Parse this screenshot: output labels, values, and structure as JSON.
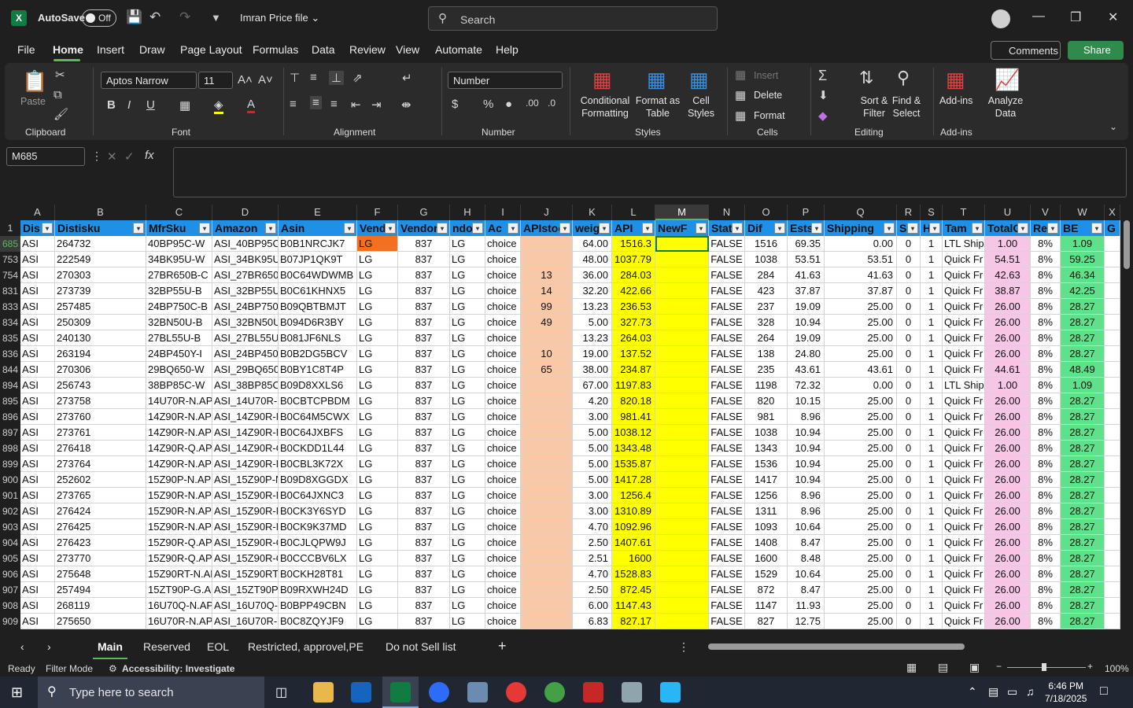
{
  "title_bar": {
    "logo": "X",
    "autosave_label": "AutoSave",
    "autosave_state": "Off",
    "file_name": "Imran Price file",
    "search_placeholder": "Search"
  },
  "menu": {
    "tabs": [
      "File",
      "Home",
      "Insert",
      "Draw",
      "Page Layout",
      "Formulas",
      "Data",
      "Review",
      "View",
      "Automate",
      "Help"
    ],
    "active_tab": "Home",
    "comments_label": "Comments",
    "share_label": "Share"
  },
  "ribbon": {
    "clipboard": {
      "paste": "Paste",
      "label": "Clipboard"
    },
    "font": {
      "name": "Aptos Narrow",
      "size": "11",
      "label": "Font"
    },
    "alignment": {
      "label": "Alignment"
    },
    "number": {
      "format": "Number",
      "label": "Number"
    },
    "styles": {
      "conditional": "Conditional\nFormatting",
      "format_table": "Format as\nTable",
      "cell_styles": "Cell\nStyles",
      "label": "Styles"
    },
    "cells": {
      "insert": "Insert",
      "delete": "Delete",
      "format": "Format",
      "label": "Cells"
    },
    "editing": {
      "sort_filter": "Sort &\nFilter",
      "find_select": "Find &\nSelect",
      "label": "Editing"
    },
    "addins": {
      "addins": "Add-ins",
      "analyze": "Analyze\nData",
      "label": "Add-ins"
    }
  },
  "formula_bar": {
    "name_box": "M685",
    "content": ""
  },
  "columns": [
    "A",
    "B",
    "C",
    "D",
    "E",
    "F",
    "G",
    "H",
    "I",
    "J",
    "K",
    "L",
    "M",
    "N",
    "O",
    "P",
    "Q",
    "R",
    "S",
    "T",
    "U",
    "V",
    "W",
    "X"
  ],
  "header_row_number": "1",
  "headers": [
    "Dis",
    "Distisku",
    "MfrSku",
    "Amazon",
    "Asin",
    "Vend",
    "Vendor",
    "ndor",
    "Ac",
    "APIstoc",
    "weig",
    "API",
    "NewF",
    "Stat",
    "Dif",
    "Ests",
    "Shipping",
    "Su",
    "H",
    "Tam",
    "TotalC",
    "Re",
    "BE",
    "G"
  ],
  "rows": [
    [
      "685",
      "ASI",
      "264732",
      "40BP95C-W",
      "ASI_40BP95C-",
      "B0B1NRCJK7",
      "LG",
      "837",
      "LG",
      "choice",
      "",
      "64.00",
      "1516.3",
      "",
      "FALSE",
      "1516",
      "69.35",
      "0.00",
      "0",
      "1",
      "LTL Shipp",
      "1.00",
      "8%",
      "1.09"
    ],
    [
      "753",
      "ASI",
      "222549",
      "34BK95U-W",
      "ASI_34BK95U-",
      "B07JP1QK9T",
      "LG",
      "837",
      "LG",
      "choice",
      "",
      "48.00",
      "1037.79",
      "",
      "FALSE",
      "1038",
      "53.51",
      "53.51",
      "0",
      "1",
      "Quick Fr",
      "54.51",
      "8%",
      "59.25"
    ],
    [
      "754",
      "ASI",
      "270303",
      "27BR650B-C",
      "ASI_27BR650B",
      "B0C64WDWMB",
      "LG",
      "837",
      "LG",
      "choice",
      "13",
      "36.00",
      "284.03",
      "",
      "FALSE",
      "284",
      "41.63",
      "41.63",
      "0",
      "1",
      "Quick Fr",
      "42.63",
      "8%",
      "46.34"
    ],
    [
      "831",
      "ASI",
      "273739",
      "32BP55U-B",
      "ASI_32BP55U-",
      "B0C61KHNX5",
      "LG",
      "837",
      "LG",
      "choice",
      "14",
      "32.20",
      "422.66",
      "",
      "FALSE",
      "423",
      "37.87",
      "37.87",
      "0",
      "1",
      "Quick Fr",
      "38.87",
      "8%",
      "42.25"
    ],
    [
      "833",
      "ASI",
      "257485",
      "24BP750C-B",
      "ASI_24BP750C",
      "B09QBTBMJT",
      "LG",
      "837",
      "LG",
      "choice",
      "99",
      "13.23",
      "236.53",
      "",
      "FALSE",
      "237",
      "19.09",
      "25.00",
      "0",
      "1",
      "Quick Fr",
      "26.00",
      "8%",
      "28.27"
    ],
    [
      "834",
      "ASI",
      "250309",
      "32BN50U-B",
      "ASI_32BN50U",
      "B094D6R3BY",
      "LG",
      "837",
      "LG",
      "choice",
      "49",
      "5.00",
      "327.73",
      "",
      "FALSE",
      "328",
      "10.94",
      "25.00",
      "0",
      "1",
      "Quick Fr",
      "26.00",
      "8%",
      "28.27"
    ],
    [
      "835",
      "ASI",
      "240130",
      "27BL55U-B",
      "ASI_27BL55U-",
      "B081JF6NLS",
      "LG",
      "837",
      "LG",
      "choice",
      "",
      "13.23",
      "264.03",
      "",
      "FALSE",
      "264",
      "19.09",
      "25.00",
      "0",
      "1",
      "Quick Fr",
      "26.00",
      "8%",
      "28.27"
    ],
    [
      "836",
      "ASI",
      "263194",
      "24BP450Y-I",
      "ASI_24BP450Y",
      "B0B2DG5BCV",
      "LG",
      "837",
      "LG",
      "choice",
      "10",
      "19.00",
      "137.52",
      "",
      "FALSE",
      "138",
      "24.80",
      "25.00",
      "0",
      "1",
      "Quick Fr",
      "26.00",
      "8%",
      "28.27"
    ],
    [
      "844",
      "ASI",
      "270306",
      "29BQ650-W",
      "ASI_29BQ650-",
      "B0BY1C8T4P",
      "LG",
      "837",
      "LG",
      "choice",
      "65",
      "38.00",
      "234.87",
      "",
      "FALSE",
      "235",
      "43.61",
      "43.61",
      "0",
      "1",
      "Quick Fr",
      "44.61",
      "8%",
      "48.49"
    ],
    [
      "894",
      "ASI",
      "256743",
      "38BP85C-W",
      "ASI_38BP85C-",
      "B09D8XXLS6",
      "LG",
      "837",
      "LG",
      "choice",
      "",
      "67.00",
      "1197.83",
      "",
      "FALSE",
      "1198",
      "72.32",
      "0.00",
      "0",
      "1",
      "LTL Shipp",
      "1.00",
      "8%",
      "1.09"
    ],
    [
      "895",
      "ASI",
      "273758",
      "14U70R-N.AP",
      "ASI_14U70R-N",
      "B0CBTCPBDM",
      "LG",
      "837",
      "LG",
      "choice",
      "",
      "4.20",
      "820.18",
      "",
      "FALSE",
      "820",
      "10.15",
      "25.00",
      "0",
      "1",
      "Quick Fr",
      "26.00",
      "8%",
      "28.27"
    ],
    [
      "896",
      "ASI",
      "273760",
      "14Z90R-N.AP",
      "ASI_14Z90R-N",
      "B0C64M5CWX",
      "LG",
      "837",
      "LG",
      "choice",
      "",
      "3.00",
      "981.41",
      "",
      "FALSE",
      "981",
      "8.96",
      "25.00",
      "0",
      "1",
      "Quick Fr",
      "26.00",
      "8%",
      "28.27"
    ],
    [
      "897",
      "ASI",
      "273761",
      "14Z90R-N.AP",
      "ASI_14Z90R-N",
      "B0C64JXBFS",
      "LG",
      "837",
      "LG",
      "choice",
      "",
      "5.00",
      "1038.12",
      "",
      "FALSE",
      "1038",
      "10.94",
      "25.00",
      "0",
      "1",
      "Quick Fr",
      "26.00",
      "8%",
      "28.27"
    ],
    [
      "898",
      "ASI",
      "276418",
      "14Z90R-Q.AP",
      "ASI_14Z90R-Q",
      "B0CKDD1L44",
      "LG",
      "837",
      "LG",
      "choice",
      "",
      "5.00",
      "1343.48",
      "",
      "FALSE",
      "1343",
      "10.94",
      "25.00",
      "0",
      "1",
      "Quick Fr",
      "26.00",
      "8%",
      "28.27"
    ],
    [
      "899",
      "ASI",
      "273764",
      "14Z90R-N.AP",
      "ASI_14Z90R-N",
      "B0CBL3K72X",
      "LG",
      "837",
      "LG",
      "choice",
      "",
      "5.00",
      "1535.87",
      "",
      "FALSE",
      "1536",
      "10.94",
      "25.00",
      "0",
      "1",
      "Quick Fr",
      "26.00",
      "8%",
      "28.27"
    ],
    [
      "900",
      "ASI",
      "252602",
      "15Z90P-N.AP",
      "ASI_15Z90P-N",
      "B09D8XGGDX",
      "LG",
      "837",
      "LG",
      "choice",
      "",
      "5.00",
      "1417.28",
      "",
      "FALSE",
      "1417",
      "10.94",
      "25.00",
      "0",
      "1",
      "Quick Fr",
      "26.00",
      "8%",
      "28.27"
    ],
    [
      "901",
      "ASI",
      "273765",
      "15Z90R-N.AP",
      "ASI_15Z90R-N",
      "B0C64JXNC3",
      "LG",
      "837",
      "LG",
      "choice",
      "",
      "3.00",
      "1256.4",
      "",
      "FALSE",
      "1256",
      "8.96",
      "25.00",
      "0",
      "1",
      "Quick Fr",
      "26.00",
      "8%",
      "28.27"
    ],
    [
      "902",
      "ASI",
      "276424",
      "15Z90R-N.AP",
      "ASI_15Z90R-N",
      "B0CK3Y6SYD",
      "LG",
      "837",
      "LG",
      "choice",
      "",
      "3.00",
      "1310.89",
      "",
      "FALSE",
      "1311",
      "8.96",
      "25.00",
      "0",
      "1",
      "Quick Fr",
      "26.00",
      "8%",
      "28.27"
    ],
    [
      "903",
      "ASI",
      "276425",
      "15Z90R-N.AP",
      "ASI_15Z90R-N",
      "B0CK9K37MD",
      "LG",
      "837",
      "LG",
      "choice",
      "",
      "4.70",
      "1092.96",
      "",
      "FALSE",
      "1093",
      "10.64",
      "25.00",
      "0",
      "1",
      "Quick Fr",
      "26.00",
      "8%",
      "28.27"
    ],
    [
      "904",
      "ASI",
      "276423",
      "15Z90R-Q.AP",
      "ASI_15Z90R-Q",
      "B0CJLQPW9J",
      "LG",
      "837",
      "LG",
      "choice",
      "",
      "2.50",
      "1407.61",
      "",
      "FALSE",
      "1408",
      "8.47",
      "25.00",
      "0",
      "1",
      "Quick Fr",
      "26.00",
      "8%",
      "28.27"
    ],
    [
      "905",
      "ASI",
      "273770",
      "15Z90R-Q.AP",
      "ASI_15Z90R-Q",
      "B0CCCBV6LX",
      "LG",
      "837",
      "LG",
      "choice",
      "",
      "2.51",
      "1600",
      "",
      "FALSE",
      "1600",
      "8.48",
      "25.00",
      "0",
      "1",
      "Quick Fr",
      "26.00",
      "8%",
      "28.27"
    ],
    [
      "906",
      "ASI",
      "275648",
      "15Z90RT-N.AP",
      "ASI_15Z90RT-",
      "B0CKH28T81",
      "LG",
      "837",
      "LG",
      "choice",
      "",
      "4.70",
      "1528.83",
      "",
      "FALSE",
      "1529",
      "10.64",
      "25.00",
      "0",
      "1",
      "Quick Fr",
      "26.00",
      "8%",
      "28.27"
    ],
    [
      "907",
      "ASI",
      "257494",
      "15ZT90P-G.AP",
      "ASI_15ZT90P-",
      "B09RXWH24D",
      "LG",
      "837",
      "LG",
      "choice",
      "",
      "2.50",
      "872.45",
      "",
      "FALSE",
      "872",
      "8.47",
      "25.00",
      "0",
      "1",
      "Quick Fr",
      "26.00",
      "8%",
      "28.27"
    ],
    [
      "908",
      "ASI",
      "268119",
      "16U70Q-N.AP",
      "ASI_16U70Q-N",
      "B0BPP49CBN",
      "LG",
      "837",
      "LG",
      "choice",
      "",
      "6.00",
      "1147.43",
      "",
      "FALSE",
      "1147",
      "11.93",
      "25.00",
      "0",
      "1",
      "Quick Fr",
      "26.00",
      "8%",
      "28.27"
    ],
    [
      "909",
      "ASI",
      "275650",
      "16U70R-N.AP",
      "ASI_16U70R-N",
      "B0C8ZQYJF9",
      "LG",
      "837",
      "LG",
      "choice",
      "",
      "6.83",
      "827.17",
      "",
      "FALSE",
      "827",
      "12.75",
      "25.00",
      "0",
      "1",
      "Quick Fr",
      "26.00",
      "8%",
      "28.27"
    ]
  ],
  "sheet_tabs": [
    "Main",
    "Reserved",
    "EOL",
    "Restricted, approvel,PE",
    "Do not Sell list"
  ],
  "active_sheet": "Main",
  "status": {
    "ready": "Ready",
    "filter_mode": "Filter Mode",
    "accessibility": "Accessibility: Investigate",
    "zoom": "100%"
  },
  "taskbar": {
    "search_placeholder": "Type here to search",
    "time": "6:46 PM",
    "date": "7/18/2025"
  },
  "colors": {
    "header_blue": "#1e90e8",
    "yellow": "#ffff00",
    "salmon": "#f8c8a8",
    "pink": "#f6c6e6",
    "green": "#5fe08a",
    "orange": "#f2701f",
    "accent": "#5cb85c"
  }
}
